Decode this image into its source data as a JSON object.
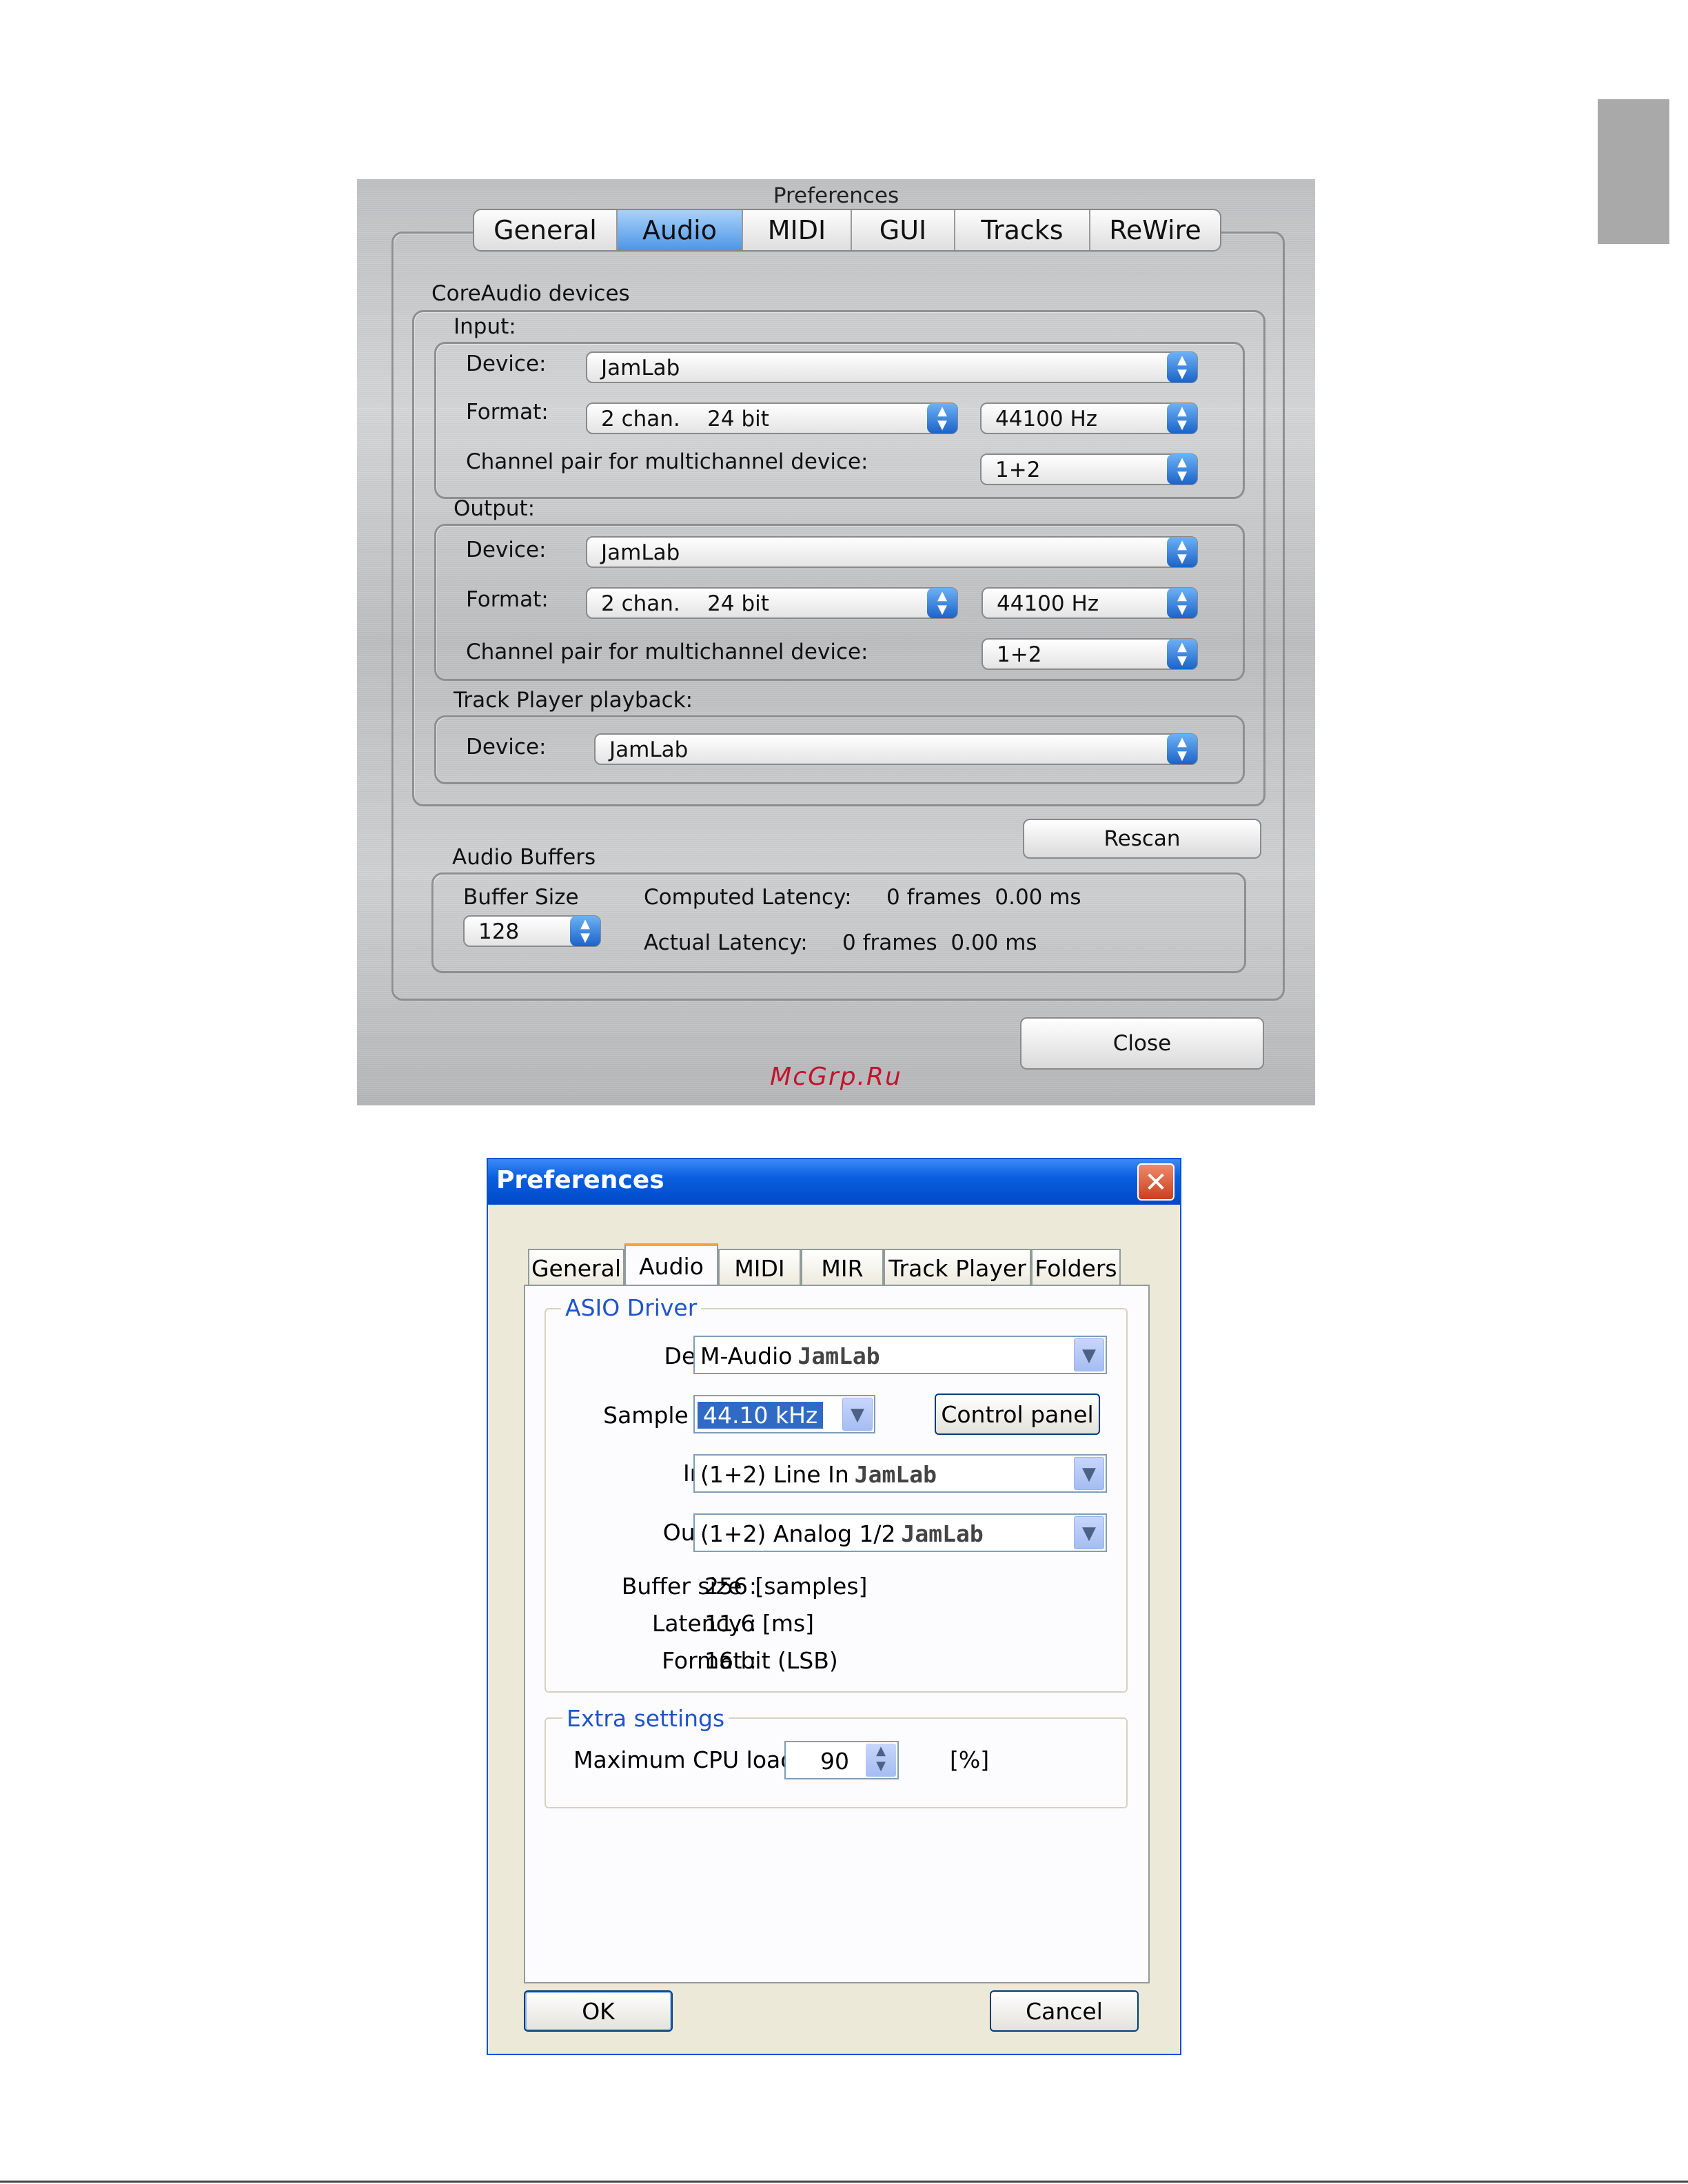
{
  "mac_dialog": {
    "title": "Preferences",
    "tabs": [
      "General",
      "Audio",
      "MIDI",
      "GUI",
      "Tracks",
      "ReWire"
    ],
    "active_tab": "Audio",
    "coreaudio_label": "CoreAudio devices",
    "input": {
      "label": "Input:",
      "device_label": "Device:",
      "device_value": "JamLab",
      "format_label": "Format:",
      "format_value": "2 chan.    24 bit",
      "rate_value": "44100 Hz",
      "channel_pair_label": "Channel pair for multichannel device:",
      "channel_pair_value": "1+2"
    },
    "output": {
      "label": "Output:",
      "device_label": "Device:",
      "device_value": "JamLab",
      "format_label": "Format:",
      "format_value": "2 chan.    24 bit",
      "rate_value": "44100 Hz",
      "channel_pair_label": "Channel pair for multichannel device:",
      "channel_pair_value": "1+2"
    },
    "track_player": {
      "label": "Track Player playback:",
      "device_label": "Device:",
      "device_value": "JamLab"
    },
    "rescan_button": "Rescan",
    "audio_buffers": {
      "label": "Audio Buffers",
      "buffer_size_label": "Buffer Size",
      "buffer_size_value": "128",
      "computed_latency_label": "Computed Latency:",
      "computed_latency_value": "0 frames  0.00 ms",
      "actual_latency_label": "Actual Latency:",
      "actual_latency_value": "0 frames  0.00 ms"
    },
    "close_button": "Close",
    "watermark": "McGrp.Ru"
  },
  "win_dialog": {
    "title": "Preferences",
    "close_glyph": "✕",
    "tabs": [
      "General",
      "Audio",
      "MIDI",
      "MIR",
      "Track Player",
      "Folders"
    ],
    "active_tab": "Audio",
    "asio_group": {
      "legend": "ASIO Driver",
      "device_label": "Device :",
      "device_value": "M-Audio",
      "device_value_brand": "JamLab",
      "sample_rate_label": "Sample rate :",
      "sample_rate_value": "44.10 kHz",
      "control_panel_button": "Control panel",
      "input_label": "Input :",
      "input_value": "(1+2) Line In",
      "input_value_brand": "JamLab",
      "output_label": "Output :",
      "output_value": "(1+2) Analog 1/2",
      "output_value_brand": "JamLab",
      "buffer_size_label": "Buffer size :",
      "buffer_size_value": "256 [samples]",
      "latency_label": "Latency :",
      "latency_value": "11.6 [ms]",
      "format_label": "Format :",
      "format_value": "16 bit (LSB)"
    },
    "extra_group": {
      "legend": "Extra settings",
      "cpu_label": "Maximum CPU load :",
      "cpu_value": "90",
      "cpu_unit": "[%]"
    },
    "ok_button": "OK",
    "cancel_button": "Cancel"
  }
}
